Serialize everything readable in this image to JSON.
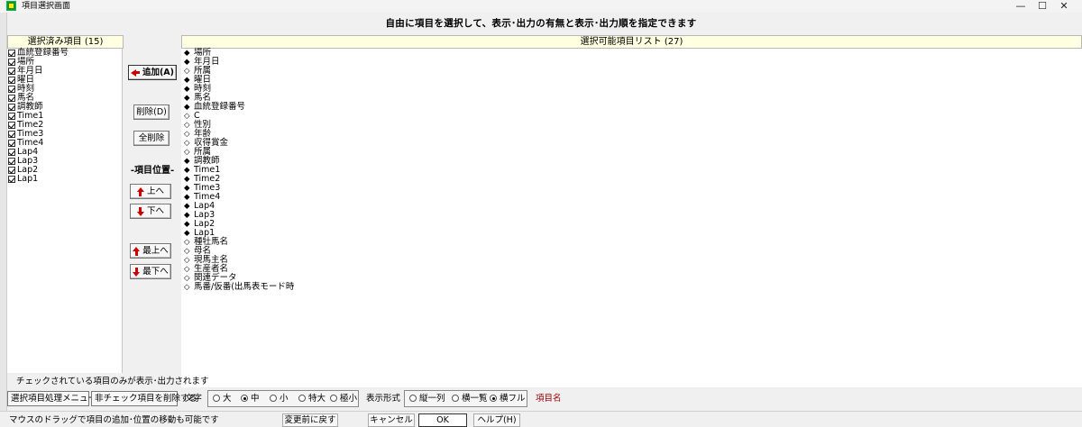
{
  "window": {
    "title": "項目選択画面",
    "controls": [
      "—",
      "☐",
      "✕"
    ]
  },
  "instruction": "自由に項目を選択して、表示･出力の有無と表示･出力順を指定できます",
  "selected_panel": {
    "header": "選択済み項目 (15)",
    "items": [
      {
        "label": "血統登録番号",
        "checked": true
      },
      {
        "label": "場所",
        "checked": true
      },
      {
        "label": "年月日",
        "checked": true
      },
      {
        "label": "曜日",
        "checked": true
      },
      {
        "label": "時刻",
        "checked": true
      },
      {
        "label": "馬名",
        "checked": true
      },
      {
        "label": "調教師",
        "checked": true
      },
      {
        "label": "Time1",
        "checked": true
      },
      {
        "label": "Time2",
        "checked": true
      },
      {
        "label": "Time3",
        "checked": true
      },
      {
        "label": "Time4",
        "checked": true
      },
      {
        "label": "Lap4",
        "checked": true
      },
      {
        "label": "Lap3",
        "checked": true
      },
      {
        "label": "Lap2",
        "checked": true
      },
      {
        "label": "Lap1",
        "checked": true
      }
    ]
  },
  "available_panel": {
    "header": "選択可能項目リスト (27)",
    "filled_marker": "◆",
    "empty_marker": "◇",
    "items": [
      {
        "label": "場所",
        "selected": true
      },
      {
        "label": "年月日",
        "selected": true
      },
      {
        "label": "所属",
        "selected": false
      },
      {
        "label": "曜日",
        "selected": true
      },
      {
        "label": "時刻",
        "selected": true
      },
      {
        "label": "馬名",
        "selected": true
      },
      {
        "label": "血統登録番号",
        "selected": true
      },
      {
        "label": "C",
        "selected": false
      },
      {
        "label": "性別",
        "selected": false
      },
      {
        "label": "年齢",
        "selected": false
      },
      {
        "label": "収得賞金",
        "selected": false
      },
      {
        "label": "所属",
        "selected": false
      },
      {
        "label": "調教師",
        "selected": true
      },
      {
        "label": "Time1",
        "selected": true
      },
      {
        "label": "Time2",
        "selected": true
      },
      {
        "label": "Time3",
        "selected": true
      },
      {
        "label": "Time4",
        "selected": true
      },
      {
        "label": "Lap4",
        "selected": true
      },
      {
        "label": "Lap3",
        "selected": true
      },
      {
        "label": "Lap2",
        "selected": true
      },
      {
        "label": "Lap1",
        "selected": true
      },
      {
        "label": "種牡馬名",
        "selected": false
      },
      {
        "label": "母名",
        "selected": false
      },
      {
        "label": "現馬主名",
        "selected": false
      },
      {
        "label": "生産者名",
        "selected": false
      },
      {
        "label": "関連データ",
        "selected": false
      },
      {
        "label": "馬番/仮番(出馬表モード時",
        "selected": false
      }
    ]
  },
  "buttons": {
    "add": "追加(A)",
    "delete": "削除(D)",
    "delete_all": "全削除",
    "position_label": "-項目位置-",
    "up": "上へ",
    "down": "下へ",
    "top": "最上へ",
    "bottom": "最下へ"
  },
  "note": "チェックされている項目のみが表示･出力されます",
  "bottom_bar": {
    "menu_button": "選択項目処理メニュー",
    "remove_unchecked_button": "非チェック項目を削除する",
    "font_label": "文字",
    "font_sizes": [
      {
        "label": "大",
        "selected": false
      },
      {
        "label": "中",
        "selected": true
      },
      {
        "label": "小",
        "selected": false
      },
      {
        "label": "特大",
        "selected": false
      },
      {
        "label": "極小",
        "selected": false
      }
    ],
    "display_label": "表示形式",
    "display_modes": [
      {
        "label": "縦一列",
        "selected": false
      },
      {
        "label": "横一覧",
        "selected": false
      },
      {
        "label": "横フル",
        "selected": true
      }
    ],
    "field_name": "項目名"
  },
  "status_bar": {
    "hint": "マウスのドラッグで項目の追加･位置の移動も可能です",
    "revert": "変更前に戻す",
    "cancel": "キャンセル",
    "ok": "OK",
    "help": "ヘルプ(H)"
  }
}
